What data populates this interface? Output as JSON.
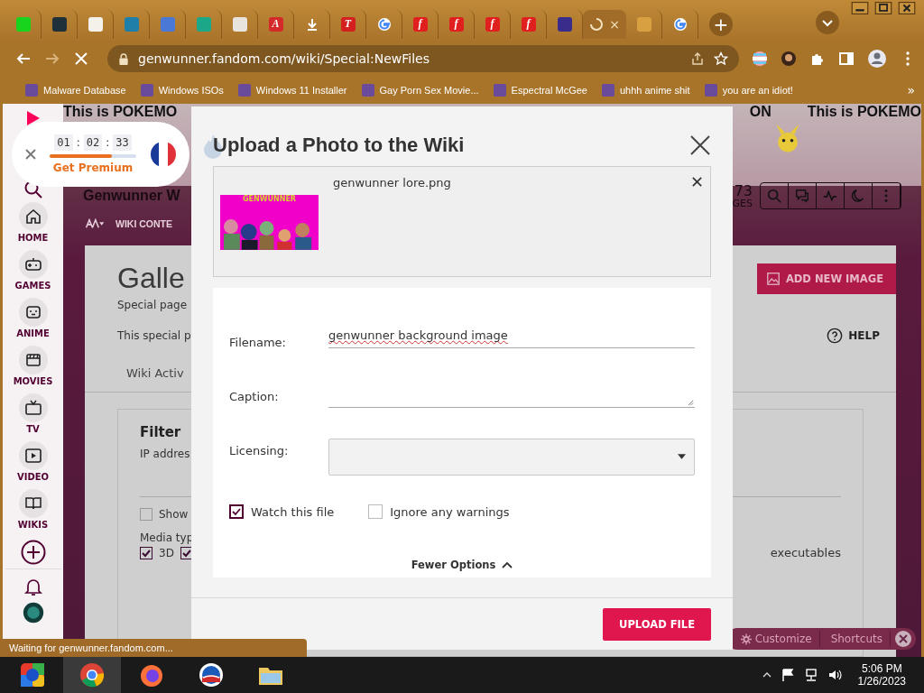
{
  "browser": {
    "tabs": [
      {
        "kind": "favicon",
        "color": "#19d41c",
        "selected": false
      },
      {
        "kind": "favicon",
        "color": "#20303a",
        "selected": false
      },
      {
        "kind": "favicon",
        "color": "#f4f0ea",
        "selected": false
      },
      {
        "kind": "favicon",
        "color": "#1f7fa8",
        "selected": false
      },
      {
        "kind": "favicon",
        "color": "#4a78d6",
        "selected": false
      },
      {
        "kind": "favicon",
        "color": "#1aa889",
        "selected": false
      },
      {
        "kind": "favicon",
        "color": "#e8e3dc",
        "selected": false
      },
      {
        "kind": "letter",
        "letter": "A",
        "color": "#d42a2a",
        "selected": false
      },
      {
        "kind": "download",
        "selected": false
      },
      {
        "kind": "letter",
        "letter": "T",
        "color": "#d41f1f",
        "selected": false
      },
      {
        "kind": "google",
        "selected": false
      },
      {
        "kind": "letter",
        "letter": "f",
        "color": "#e0201f",
        "selected": false
      },
      {
        "kind": "letter",
        "letter": "f",
        "color": "#e0201f",
        "selected": false
      },
      {
        "kind": "letter",
        "letter": "f",
        "color": "#e0201f",
        "selected": false
      },
      {
        "kind": "letter",
        "letter": "f",
        "color": "#e0201f",
        "selected": false
      },
      {
        "kind": "favicon",
        "color": "#3a2c8a",
        "selected": false
      },
      {
        "kind": "loading",
        "close": "×",
        "selected": true
      },
      {
        "kind": "favicon",
        "color": "#d8a040",
        "selected": false
      },
      {
        "kind": "google",
        "selected": false
      }
    ],
    "new_tab": "+",
    "url": "genwunner.fandom.com/wiki/Special:NewFiles",
    "bookmarks": [
      "Malware Database",
      "Windows ISOs",
      "Windows 11 Installer",
      "Gay Porn Sex Movie...",
      "Espectral McGee",
      "uhhh anime shit",
      "you are an idiot!"
    ],
    "bookmarks_more": "»"
  },
  "timer": {
    "hours": "01",
    "minutes": "02",
    "seconds": "33",
    "separator": ":",
    "level": 0.72,
    "cta": "Get Premium"
  },
  "sidebar": {
    "items": [
      {
        "kind": "home",
        "label": "HOME"
      },
      {
        "kind": "games",
        "label": "GAMES"
      },
      {
        "kind": "anime",
        "label": "ANIME"
      },
      {
        "kind": "movies",
        "label": "MOVIES"
      },
      {
        "kind": "tv",
        "label": "TV"
      },
      {
        "kind": "video",
        "label": "VIDEO"
      },
      {
        "kind": "wikis",
        "label": "WIKIS"
      }
    ]
  },
  "wiki": {
    "banner_left": "This is POKEMO",
    "banner_mid": "ON",
    "banner_right": "This is POKEMO",
    "name": "Genwunner W",
    "pages_count": "73",
    "pages_label": "GES",
    "nav": "WIKI CONTE",
    "page_title": "Galle",
    "subtitle": "Special page",
    "intro": "This special p",
    "tab": "Wiki Activ",
    "add_button": "ADD NEW IMAGE",
    "help": "HELP",
    "filter": {
      "title": "Filter",
      "ip_label": "IP addres",
      "show_label": "Show",
      "show_checked": false,
      "media_label": "Media typ",
      "media": [
        {
          "label": "3D",
          "checked": true
        },
        {
          "checked": true
        }
      ],
      "executables": "executables"
    },
    "toolbar": {
      "customize": "Customize",
      "shortcuts": "Shortcuts"
    }
  },
  "dialog": {
    "title": "Upload a Photo to the Wiki",
    "file_name": "genwunner lore.png",
    "thumb_caption": "GENWUNNER",
    "fields": [
      {
        "kind": "text",
        "label": "Filename:",
        "value": "genwunner background image"
      },
      {
        "kind": "textarea",
        "label": "Caption:"
      },
      {
        "kind": "select",
        "label": "Licensing:"
      }
    ],
    "options": [
      {
        "label": "Watch this file",
        "checked": true
      },
      {
        "label": "Ignore any warnings",
        "checked": false
      }
    ],
    "toggle": "Fewer Options",
    "submit": "UPLOAD FILE"
  },
  "status_bar": "Waiting for genwunner.fandom.com...",
  "taskbar": {
    "apps": [
      {
        "kind": "orb",
        "selected": false
      },
      {
        "kind": "chrome",
        "selected": true
      },
      {
        "kind": "firefox",
        "selected": false
      },
      {
        "kind": "circle",
        "selected": false
      },
      {
        "kind": "folder",
        "selected": false
      }
    ],
    "time": "5:06 PM",
    "date": "1/26/2023"
  }
}
